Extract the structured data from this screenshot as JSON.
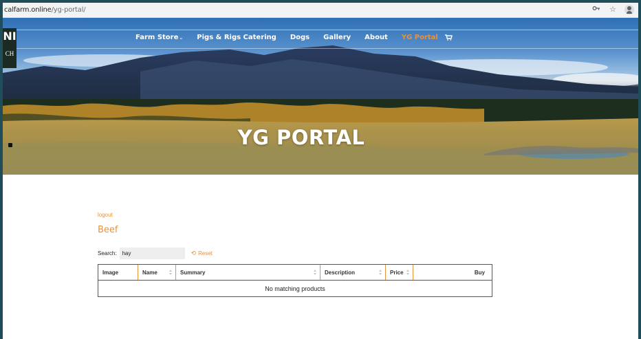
{
  "browser": {
    "url_host": "calfarm.online",
    "url_path": "/yg-portal/"
  },
  "logo": {
    "line1": "NI",
    "line2": "CH"
  },
  "nav": {
    "items": [
      {
        "label": "Farm Store",
        "has_dropdown": true
      },
      {
        "label": "Pigs & Rigs Catering"
      },
      {
        "label": "Dogs"
      },
      {
        "label": "Gallery"
      },
      {
        "label": "About"
      },
      {
        "label": "YG Portal",
        "active": true
      }
    ],
    "dropdown_glyph": "⌄"
  },
  "hero": {
    "title": "YG PORTAL"
  },
  "content": {
    "logout_label": "logout",
    "section_title": "Beef",
    "search": {
      "label": "Search:",
      "value": "hay"
    },
    "reset_label": "Reset"
  },
  "table": {
    "columns": [
      "Image",
      "Name",
      "Summary",
      "Description",
      "Price",
      "Buy"
    ],
    "empty_message": "No matching products"
  },
  "colors": {
    "accent": "#e8913a",
    "border_teal": "#1f4e5a"
  }
}
